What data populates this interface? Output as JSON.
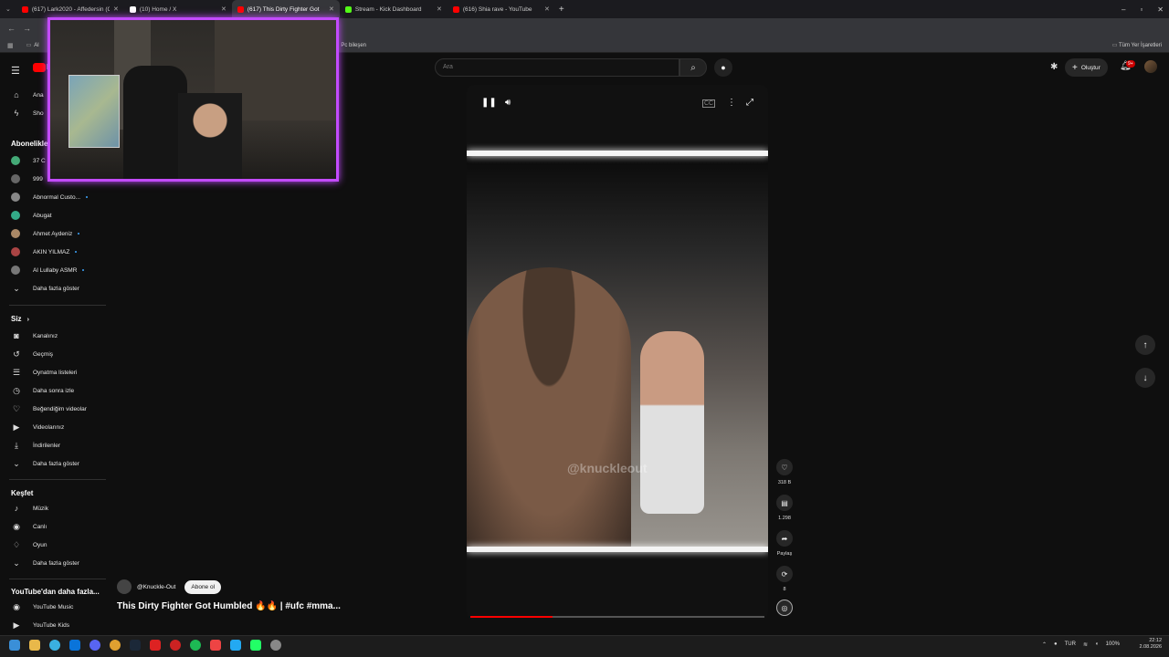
{
  "browser": {
    "tabs": [
      {
        "title": "(617) Lark2020 - Affedersin (Off",
        "active": false,
        "color": "#ff0000"
      },
      {
        "title": "(10) Home / X",
        "active": false,
        "color": "#ffffff"
      },
      {
        "title": "(617) This Dirty Fighter Got",
        "active": true,
        "color": "#ff0000"
      },
      {
        "title": "Stream - Kick Dashboard",
        "active": false,
        "color": "#53fc18"
      },
      {
        "title": "(616) Shia rave - YouTube",
        "active": false,
        "color": "#ff0000"
      }
    ],
    "bookmarks": {
      "left": "Al",
      "middle": "Pc bileşen",
      "right": "Tüm Yer İşaretleri"
    }
  },
  "youtube": {
    "search_placeholder": "Ara",
    "create_label": "Oluştur",
    "notification_badge": "9+",
    "logo_letter": "P"
  },
  "sidebar": {
    "top_items": [
      "Ana",
      "Sho"
    ],
    "subscriptions_heading": "Abonelikle",
    "subscriptions": [
      {
        "label": "37 C",
        "color": "#4a7"
      },
      {
        "label": "999",
        "color": "#666"
      },
      {
        "label": "Abnormal Custo...",
        "color": "#888"
      },
      {
        "label": "Abugat",
        "color": "#3a8"
      },
      {
        "label": "Ahmet Aydeniz",
        "color": "#a86"
      },
      {
        "label": "AKIN YILMAZ",
        "color": "#a44"
      },
      {
        "label": "Al Lullaby ASMR",
        "color": "#777"
      },
      {
        "label": "Daha fazla göster",
        "color": ""
      }
    ],
    "you_heading": "Siz",
    "you_items": [
      {
        "label": "Kanalınız",
        "icon": "◙"
      },
      {
        "label": "Geçmiş",
        "icon": "↺"
      },
      {
        "label": "Oynatma listeleri",
        "icon": "☰"
      },
      {
        "label": "Daha sonra izle",
        "icon": "◷"
      },
      {
        "label": "Beğendiğim videolar",
        "icon": "♡"
      },
      {
        "label": "Videolarınız",
        "icon": "▶"
      },
      {
        "label": "İndirilenler",
        "icon": "⤓"
      },
      {
        "label": "Daha fazla göster",
        "icon": "⌄"
      }
    ],
    "explore_heading": "Keşfet",
    "explore_items": [
      {
        "label": "Müzik",
        "icon": "♪"
      },
      {
        "label": "Canlı",
        "icon": "◉"
      },
      {
        "label": "Oyun",
        "icon": "♢"
      },
      {
        "label": "Daha fazla göster",
        "icon": "⌄"
      }
    ],
    "more_heading": "YouTube'dan daha fazla...",
    "more_items": [
      {
        "label": "YouTube Music",
        "icon": "◉"
      },
      {
        "label": "YouTube Kids",
        "icon": "▶"
      }
    ]
  },
  "short": {
    "watermark": "@knuckleout",
    "channel": "@Knuckle-Out",
    "subscribe_label": "Abone ol",
    "title": "This Dirty Fighter Got Humbled 🔥🔥 | #ufc #mma...",
    "progress_fraction": 0.28,
    "likes": "318 B",
    "comments": "1.298",
    "share_label": "Paylaş",
    "remix_count": "8"
  },
  "taskbar": {
    "language": "TUR",
    "battery": "100%",
    "time": "22:12",
    "date": "2.08.2026"
  }
}
